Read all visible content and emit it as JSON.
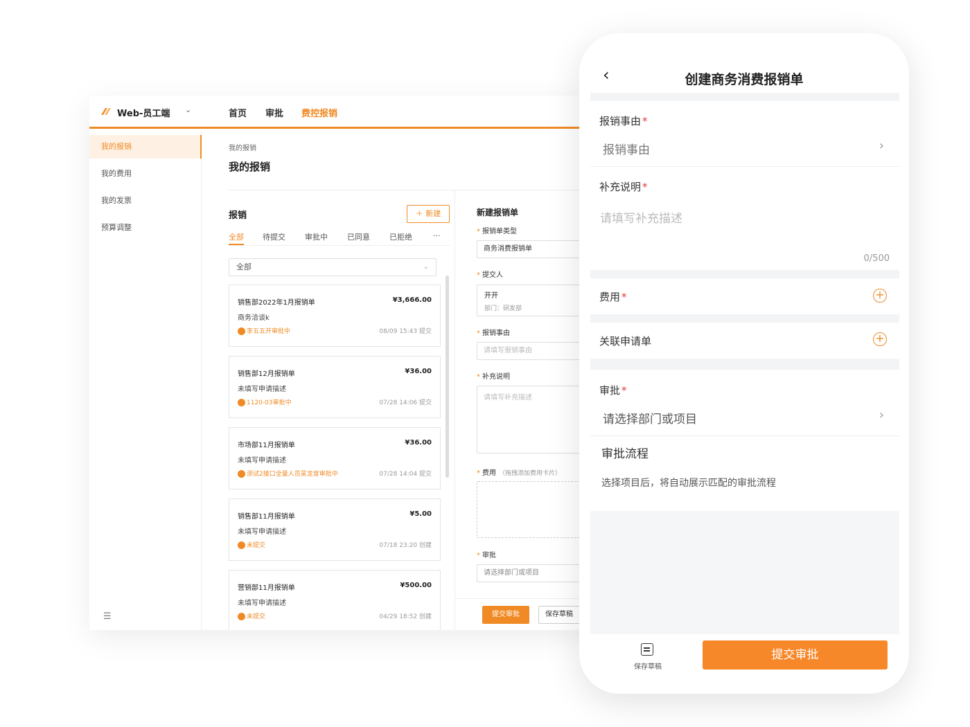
{
  "web": {
    "brand": "Web-员工端",
    "nav": [
      "首页",
      "审批",
      "费控报销"
    ],
    "sidebar": [
      "我的报销",
      "我的费用",
      "我的发票",
      "预算调整"
    ],
    "breadcrumb": "我的报销",
    "page_title": "我的报销",
    "list": {
      "title": "报销",
      "new_label": "＋ 新建",
      "tabs": [
        "全部",
        "待提交",
        "审批中",
        "已同意",
        "已拒绝",
        "···"
      ],
      "filter_value": "全部",
      "cards": [
        {
          "title": "销售部2022年1月报销单",
          "amount": "¥3,666.00",
          "desc": "商务洽谈k",
          "status": "李五五开审批中",
          "time": "08/09 15:43 提交"
        },
        {
          "title": "销售部12月报销单",
          "amount": "¥36.00",
          "desc": "未填写申请描述",
          "status": "1120-03审批中",
          "time": "07/28 14:06 提交"
        },
        {
          "title": "市场部11月报销单",
          "amount": "¥36.00",
          "desc": "未填写申请描述",
          "status": "测试2接口全量人员吴龙音审批中",
          "time": "07/28 14:04 提交"
        },
        {
          "title": "销售部11月报销单",
          "amount": "¥5.00",
          "desc": "未填写申请描述",
          "status": "未提交",
          "time": "07/18 23:20 创建"
        },
        {
          "title": "营销部11月报销单",
          "amount": "¥500.00",
          "desc": "未填写申请描述",
          "status": "未提交",
          "time": "04/29 18:52 创建"
        }
      ]
    },
    "form": {
      "title": "新建报销单",
      "type_label": "报销单类型",
      "type_value": "商务消费报销单",
      "submitter_label": "提交人",
      "submitter_name": "开开",
      "submitter_dept": "部门：研发部",
      "reason_label": "报销事由",
      "reason_placeholder": "请填写报销事由",
      "note_label": "补充说明",
      "note_placeholder": "请填写补充描述",
      "fee_label": "费用",
      "fee_hint": "（拖拽添加费用卡片）",
      "approval_label": "审批",
      "approval_placeholder": "请选择部门或项目",
      "submit": "提交审批",
      "draft": "保存草稿"
    }
  },
  "phone": {
    "title": "创建商务消费报销单",
    "reason_label": "报销事由",
    "reason_value": "报销事由",
    "note_label": "补充说明",
    "note_placeholder": "请填写补充描述",
    "note_count": "0/500",
    "fee_label": "费用",
    "related_label": "关联申请单",
    "approval_label": "审批",
    "approval_placeholder": "请选择部门或项目",
    "flow_title": "审批流程",
    "flow_desc": "选择项目后，将自动展示匹配的审批流程",
    "draft_label": "保存草稿",
    "submit_label": "提交审批"
  },
  "colors": {
    "accent": "#f08a24",
    "required": "#e53935"
  }
}
